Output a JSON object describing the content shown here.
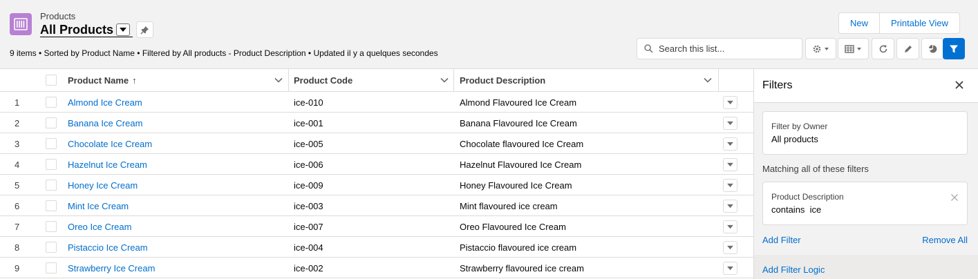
{
  "header": {
    "object_label": "Products",
    "list_title": "All Products",
    "meta": "9 items • Sorted by Product Name • Filtered by All products - Product Description • Updated il y a quelques secondes",
    "buttons": {
      "new": "New",
      "printable": "Printable View"
    },
    "search": {
      "placeholder": "Search this list...",
      "value": ""
    },
    "icons": [
      "gear-icon",
      "table-icon",
      "refresh-icon",
      "pencil-icon",
      "pie-chart-icon",
      "filter-icon"
    ]
  },
  "table": {
    "columns": [
      {
        "label": "Product Name",
        "sort": "↑"
      },
      {
        "label": "Product Code"
      },
      {
        "label": "Product Description"
      }
    ],
    "rows": [
      {
        "num": "1",
        "name": "Almond Ice Cream",
        "code": "ice-010",
        "desc": "Almond Flavoured Ice Cream"
      },
      {
        "num": "2",
        "name": "Banana Ice Cream",
        "code": "ice-001",
        "desc": "Banana Flavoured Ice Cream"
      },
      {
        "num": "3",
        "name": "Chocolate Ice Cream",
        "code": "ice-005",
        "desc": "Chocolate flavoured Ice Cream"
      },
      {
        "num": "4",
        "name": "Hazelnut Ice Cream",
        "code": "ice-006",
        "desc": "Hazelnut Flavoured Ice Cream"
      },
      {
        "num": "5",
        "name": "Honey Ice Cream",
        "code": "ice-009",
        "desc": "Honey Flavoured Ice Cream"
      },
      {
        "num": "6",
        "name": "Mint Ice Cream",
        "code": "ice-003",
        "desc": "Mint flavoured ice cream"
      },
      {
        "num": "7",
        "name": "Oreo Ice Cream",
        "code": "ice-007",
        "desc": "Oreo Flavoured Ice Cream"
      },
      {
        "num": "8",
        "name": "Pistaccio Ice Cream",
        "code": "ice-004",
        "desc": "Pistaccio flavoured ice cream"
      },
      {
        "num": "9",
        "name": "Strawberry Ice Cream",
        "code": "ice-002",
        "desc": "Strawberry flavoured ice cream"
      }
    ]
  },
  "filters": {
    "title": "Filters",
    "owner": {
      "label": "Filter by Owner",
      "value": "All products"
    },
    "matching_label": "Matching all of these filters",
    "items": [
      {
        "field": "Product Description",
        "condition": "contains  ice"
      }
    ],
    "add_filter": "Add Filter",
    "remove_all": "Remove All",
    "add_logic": "Add Filter Logic"
  },
  "colors": {
    "brand": "#0070d2",
    "link": "#006dcc",
    "object_icon": "#b781d3"
  }
}
